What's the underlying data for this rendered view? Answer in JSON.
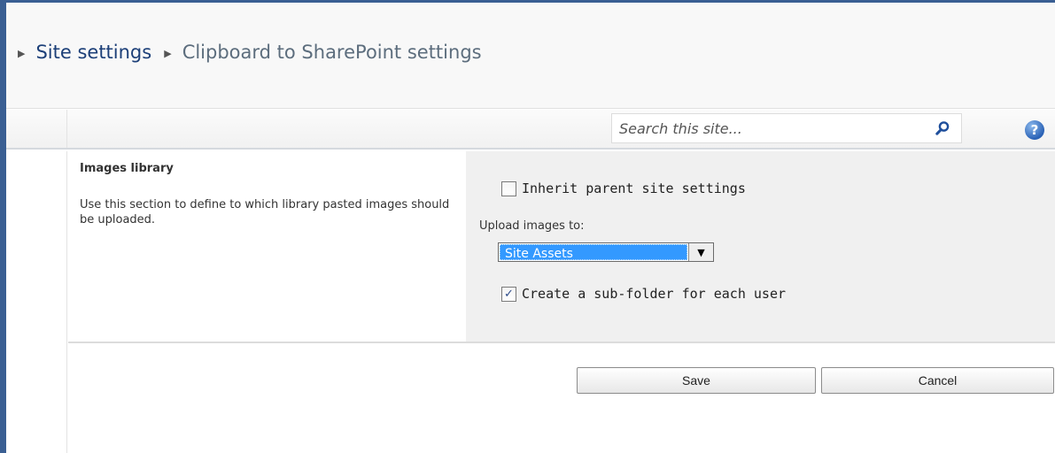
{
  "breadcrumb": {
    "parent": "Site settings",
    "current": "Clipboard to SharePoint settings"
  },
  "search": {
    "placeholder": "Search this site..."
  },
  "help": {
    "glyph": "?"
  },
  "section": {
    "title": "Images library",
    "description": "Use this section to define to which library pasted images should be uploaded."
  },
  "form": {
    "inherit_label": "Inherit parent site settings",
    "inherit_checked": false,
    "upload_label": "Upload images to:",
    "upload_selected": "Site Assets",
    "subfolder_label": "Create a sub-folder for each user",
    "subfolder_checked": true
  },
  "buttons": {
    "save": "Save",
    "cancel": "Cancel"
  },
  "colors": {
    "frame": "#3a5f93",
    "link": "#1c3f78",
    "selection": "#3399ff"
  },
  "icons": {
    "search": "magnifier-icon",
    "help": "help-icon",
    "dropdown": "triangle-down-icon"
  }
}
